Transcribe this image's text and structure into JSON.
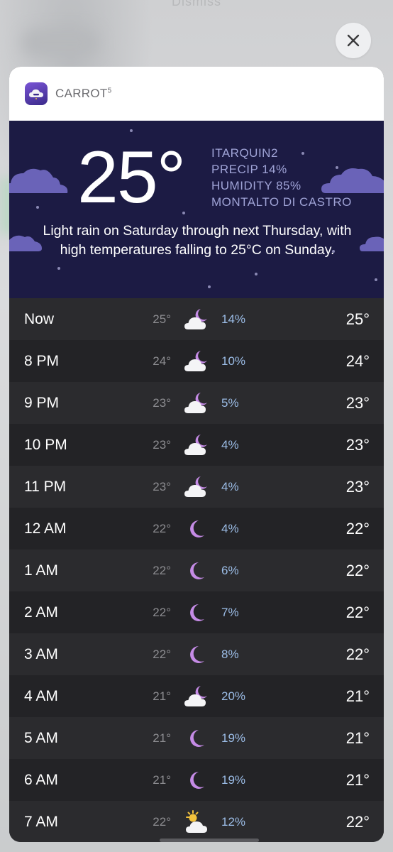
{
  "dismiss_label": "Dismiss",
  "app": {
    "name": "CARROT",
    "name_sup": "5",
    "icon": "carrot-cloud-icon"
  },
  "current": {
    "temperature": "25°",
    "station": "ITARQUIN2",
    "precip": "PRECIP 14%",
    "humidity": "HUMIDITY 85%",
    "location": "MONTALTO DI CASTRO",
    "summary": "Light rain on Saturday through next Thursday, with high temperatures falling to 25°C on Sunday."
  },
  "hourly": [
    {
      "time": "Now",
      "low": "25°",
      "icon": "cloud-moon",
      "precip": "14%",
      "high": "25°"
    },
    {
      "time": "8 PM",
      "low": "24°",
      "icon": "cloud-moon",
      "precip": "10%",
      "high": "24°"
    },
    {
      "time": "9 PM",
      "low": "23°",
      "icon": "cloud-moon",
      "precip": "5%",
      "high": "23°"
    },
    {
      "time": "10 PM",
      "low": "23°",
      "icon": "cloud-moon",
      "precip": "4%",
      "high": "23°"
    },
    {
      "time": "11 PM",
      "low": "23°",
      "icon": "cloud-moon",
      "precip": "4%",
      "high": "23°"
    },
    {
      "time": "12 AM",
      "low": "22°",
      "icon": "moon",
      "precip": "4%",
      "high": "22°"
    },
    {
      "time": "1 AM",
      "low": "22°",
      "icon": "moon",
      "precip": "6%",
      "high": "22°"
    },
    {
      "time": "2 AM",
      "low": "22°",
      "icon": "moon",
      "precip": "7%",
      "high": "22°"
    },
    {
      "time": "3 AM",
      "low": "22°",
      "icon": "moon",
      "precip": "8%",
      "high": "22°"
    },
    {
      "time": "4 AM",
      "low": "21°",
      "icon": "cloud-moon",
      "precip": "20%",
      "high": "21°"
    },
    {
      "time": "5 AM",
      "low": "21°",
      "icon": "moon",
      "precip": "19%",
      "high": "21°"
    },
    {
      "time": "6 AM",
      "low": "21°",
      "icon": "moon",
      "precip": "19%",
      "high": "21°"
    },
    {
      "time": "7 AM",
      "low": "22°",
      "icon": "cloud-sun",
      "precip": "12%",
      "high": "22°"
    }
  ],
  "colors": {
    "hero_bg": "#1c1b44",
    "moon": "#c58be6",
    "sun": "#f2c23c",
    "precip_text": "#9bbce6"
  }
}
